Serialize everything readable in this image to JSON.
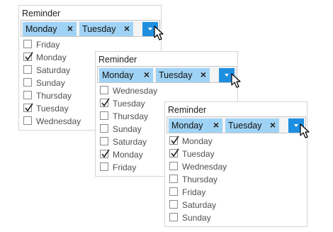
{
  "panels": [
    {
      "title": "Reminder",
      "tags": [
        "Monday",
        "Tuesday"
      ],
      "remove_glyph": "×",
      "items": [
        {
          "label": "Friday",
          "checked": false
        },
        {
          "label": "Monday",
          "checked": true
        },
        {
          "label": "Saturday",
          "checked": false
        },
        {
          "label": "Sunday",
          "checked": false
        },
        {
          "label": "Thursday",
          "checked": false
        },
        {
          "label": "Tuesday",
          "checked": true
        },
        {
          "label": "Wednesday",
          "checked": false
        }
      ]
    },
    {
      "title": "Reminder",
      "tags": [
        "Monday",
        "Tuesday"
      ],
      "remove_glyph": "×",
      "items": [
        {
          "label": "Wednesday",
          "checked": false
        },
        {
          "label": "Tuesday",
          "checked": true
        },
        {
          "label": "Thursday",
          "checked": false
        },
        {
          "label": "Sunday",
          "checked": false
        },
        {
          "label": "Saturday",
          "checked": false
        },
        {
          "label": "Monday",
          "checked": true
        },
        {
          "label": "Friday",
          "checked": false
        }
      ]
    },
    {
      "title": "Reminder",
      "tags": [
        "Monday",
        "Tuesday"
      ],
      "remove_glyph": "×",
      "items": [
        {
          "label": "Monday",
          "checked": true
        },
        {
          "label": "Tuesday",
          "checked": true
        },
        {
          "label": "Wednesday",
          "checked": false
        },
        {
          "label": "Thursday",
          "checked": false
        },
        {
          "label": "Friday",
          "checked": false
        },
        {
          "label": "Saturday",
          "checked": false
        },
        {
          "label": "Sunday",
          "checked": false
        }
      ]
    }
  ],
  "colors": {
    "tag_background": "#9fd3f5",
    "dropdown_button": "#1e8fe0",
    "border": "#d4d4d4"
  },
  "icons": {
    "dropdown": "chevron-down-icon",
    "cursor": "mouse-pointer-icon",
    "remove": "close-icon",
    "check": "checkmark-icon"
  }
}
